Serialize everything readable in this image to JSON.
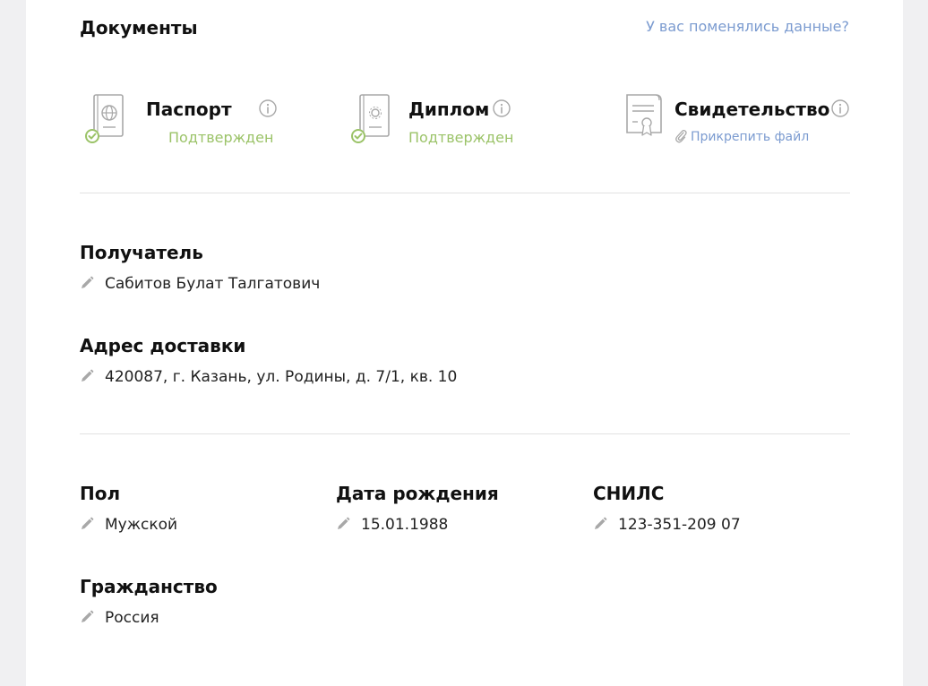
{
  "documents": {
    "title": "Документы",
    "changed_link": "У вас поменялись данные?",
    "items": [
      {
        "title": "Паспорт",
        "status": "Подтвержден",
        "icon": "passport-icon"
      },
      {
        "title": "Диплом",
        "status": "Подтвержден",
        "icon": "diploma-icon"
      },
      {
        "title": "Свидетельство",
        "attach_label": "Прикрепить файл",
        "icon": "certificate-icon"
      }
    ]
  },
  "recipient": {
    "label": "Получатель",
    "value": "Сабитов Булат Талгатович"
  },
  "address": {
    "label": "Адрес доставки",
    "value": "420087, г. Казань, ул. Родины, д. 7/1, кв. 10"
  },
  "gender": {
    "label": "Пол",
    "value": "Мужской"
  },
  "birthdate": {
    "label": "Дата рождения",
    "value": "15.01.1988"
  },
  "snils": {
    "label": "СНИЛС",
    "value": "123-351-209 07"
  },
  "citizenship": {
    "label": "Гражданство",
    "value": "Россия"
  },
  "colors": {
    "status_ok": "#9bc368",
    "link": "#7b9bd0",
    "icon_gray": "#a8a8a8"
  }
}
